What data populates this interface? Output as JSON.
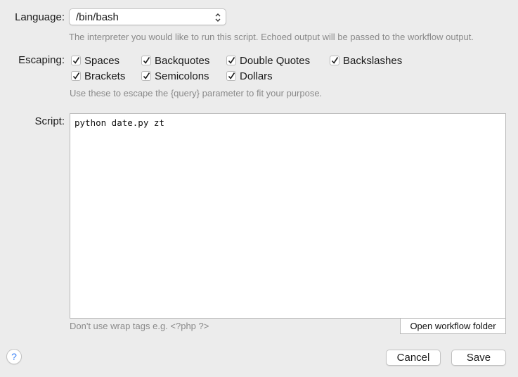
{
  "language": {
    "label": "Language:",
    "value": "/bin/bash",
    "hint": "The interpreter you would like to run this script. Echoed output will be passed to the workflow output."
  },
  "escaping": {
    "label": "Escaping:",
    "options": [
      {
        "label": "Spaces",
        "checked": true
      },
      {
        "label": "Backquotes",
        "checked": true
      },
      {
        "label": "Double Quotes",
        "checked": true
      },
      {
        "label": "Backslashes",
        "checked": true
      },
      {
        "label": "Brackets",
        "checked": true
      },
      {
        "label": "Semicolons",
        "checked": true
      },
      {
        "label": "Dollars",
        "checked": true
      }
    ],
    "hint": "Use these to escape the {query} parameter to fit your purpose."
  },
  "script": {
    "label": "Script:",
    "content": "python date.py zt",
    "hint": "Don't use wrap tags e.g. <?php ?>",
    "open_folder_label": "Open workflow folder"
  },
  "footer": {
    "help_label": "?",
    "cancel_label": "Cancel",
    "save_label": "Save"
  },
  "colors": {
    "background": "#ececec",
    "hint_text": "#8a8a8a",
    "help_accent": "#3b82f6"
  },
  "icons": {
    "select_arrows": "up-down-chevron-icon",
    "checkbox_mark": "checkmark-icon",
    "help": "question-mark-icon"
  }
}
